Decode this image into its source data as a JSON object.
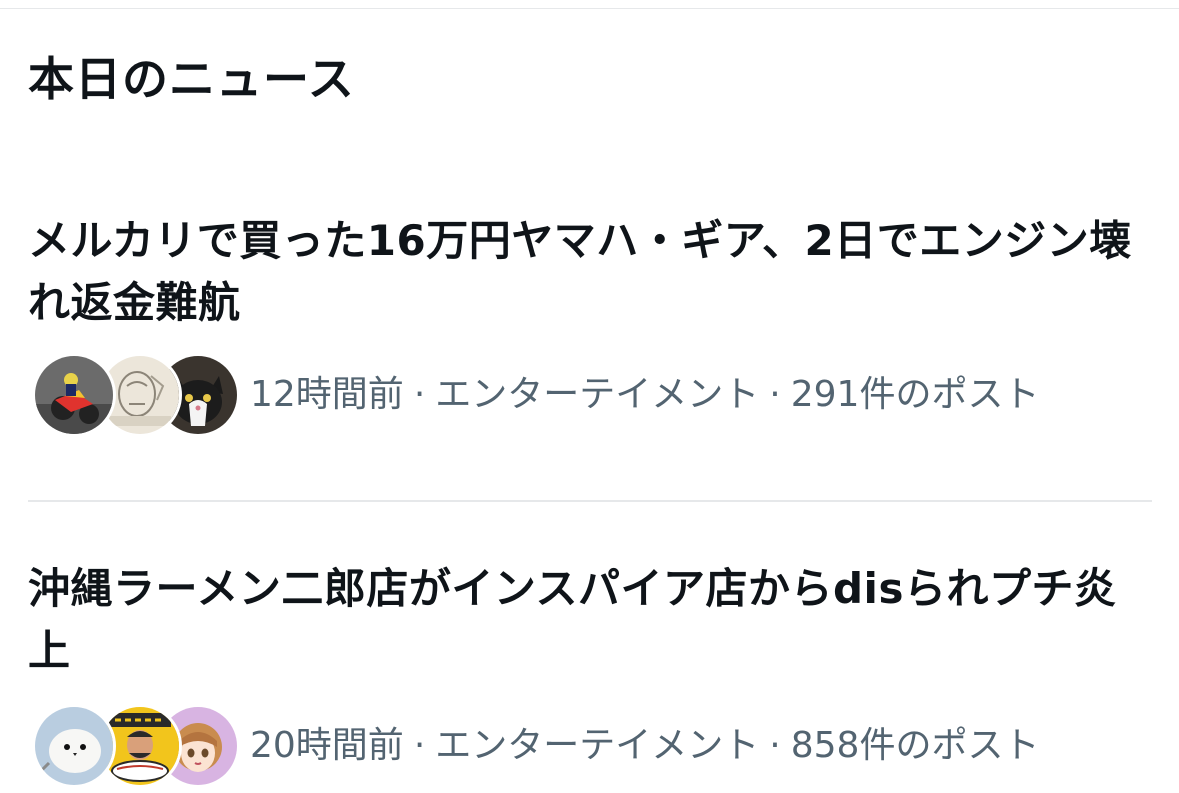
{
  "section": {
    "title": "本日のニュース"
  },
  "news": [
    {
      "headline": "メルカリで買った16万円ヤマハ・ギア、2日でエンジン壊れ返金難航",
      "time": "12時間前",
      "category": "エンターテイメント",
      "posts": "291件のポスト",
      "separator": "·",
      "avatars": [
        "motorcycle-photo-avatar",
        "sketch-drawing-avatar",
        "cat-photo-avatar"
      ]
    },
    {
      "headline": "沖縄ラーメン二郎店がインスパイア店からdisられプチ炎上",
      "time": "20時間前",
      "category": "エンターテイメント",
      "posts": "858件のポスト",
      "separator": "·",
      "avatars": [
        "white-bird-photo-avatar",
        "ramen-cartoon-avatar",
        "anime-girl-avatar"
      ]
    }
  ],
  "colors": {
    "text": "#0f1419",
    "meta": "#536471",
    "divider": "#e6e8ea"
  }
}
